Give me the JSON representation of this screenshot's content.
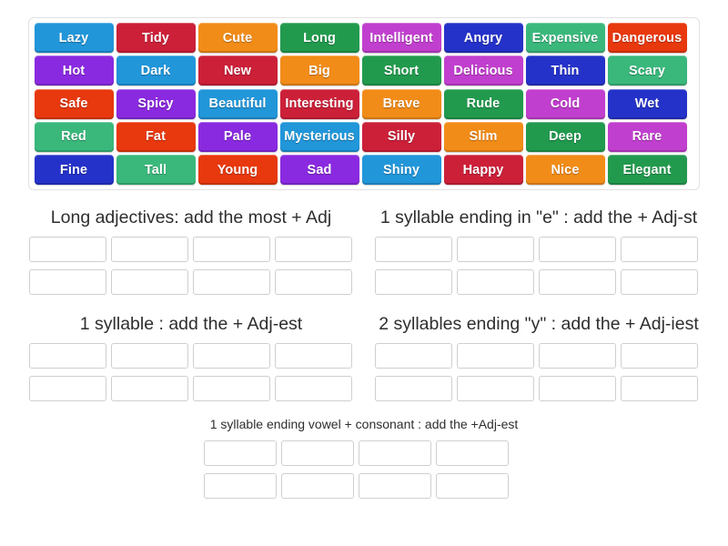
{
  "activity": {
    "type": "group-sort",
    "palette": {
      "blue": "#2196d9",
      "crimson": "#cc2039",
      "orange": "#f28c18",
      "green": "#229a4e",
      "orchid": "#c13fce",
      "indigo": "#2532c9",
      "seagreen": "#3ab87c",
      "orangered": "#e8380d",
      "violet": "#8a2ae0"
    }
  },
  "wordbank": {
    "rows": [
      [
        {
          "label": "Lazy",
          "color": "blue"
        },
        {
          "label": "Tidy",
          "color": "crimson"
        },
        {
          "label": "Cute",
          "color": "orange"
        },
        {
          "label": "Long",
          "color": "green"
        },
        {
          "label": "Intelligent",
          "color": "orchid"
        },
        {
          "label": "Angry",
          "color": "indigo"
        },
        {
          "label": "Expensive",
          "color": "seagreen"
        },
        {
          "label": "Dangerous",
          "color": "orangered"
        }
      ],
      [
        {
          "label": "Hot",
          "color": "violet"
        },
        {
          "label": "Dark",
          "color": "blue"
        },
        {
          "label": "New",
          "color": "crimson"
        },
        {
          "label": "Big",
          "color": "orange"
        },
        {
          "label": "Short",
          "color": "green"
        },
        {
          "label": "Delicious",
          "color": "orchid"
        },
        {
          "label": "Thin",
          "color": "indigo"
        },
        {
          "label": "Scary",
          "color": "seagreen"
        }
      ],
      [
        {
          "label": "Safe",
          "color": "orangered"
        },
        {
          "label": "Spicy",
          "color": "violet"
        },
        {
          "label": "Beautiful",
          "color": "blue"
        },
        {
          "label": "Interesting",
          "color": "crimson"
        },
        {
          "label": "Brave",
          "color": "orange"
        },
        {
          "label": "Rude",
          "color": "green"
        },
        {
          "label": "Cold",
          "color": "orchid"
        },
        {
          "label": "Wet",
          "color": "indigo"
        }
      ],
      [
        {
          "label": "Red",
          "color": "seagreen"
        },
        {
          "label": "Fat",
          "color": "orangered"
        },
        {
          "label": "Pale",
          "color": "violet"
        },
        {
          "label": "Mysterious",
          "color": "blue"
        },
        {
          "label": "Silly",
          "color": "crimson"
        },
        {
          "label": "Slim",
          "color": "orange"
        },
        {
          "label": "Deep",
          "color": "green"
        },
        {
          "label": "Rare",
          "color": "orchid"
        }
      ],
      [
        {
          "label": "Fine",
          "color": "indigo"
        },
        {
          "label": "Tall",
          "color": "seagreen"
        },
        {
          "label": "Young",
          "color": "orangered"
        },
        {
          "label": "Sad",
          "color": "violet"
        },
        {
          "label": "Shiny",
          "color": "blue"
        },
        {
          "label": "Happy",
          "color": "crimson"
        },
        {
          "label": "Nice",
          "color": "orange"
        },
        {
          "label": "Elegant",
          "color": "green"
        }
      ]
    ]
  },
  "categories": [
    {
      "id": "long",
      "title": "Long adjectives: add the most + Adj",
      "zone_count": 8
    },
    {
      "id": "ending-e",
      "title": "1 syllable ending in \"e\" : add the + Adj-st",
      "zone_count": 8
    },
    {
      "id": "one-syllable",
      "title": "1 syllable : add the + Adj-est",
      "zone_count": 8
    },
    {
      "id": "two-syllables-y",
      "title": "2 syllables ending \"y\" : add the + Adj-iest",
      "zone_count": 8
    },
    {
      "id": "vowel-consonant",
      "title": "1 syllable ending vowel + consonant : add the +Adj-est",
      "zone_count": 8
    }
  ]
}
